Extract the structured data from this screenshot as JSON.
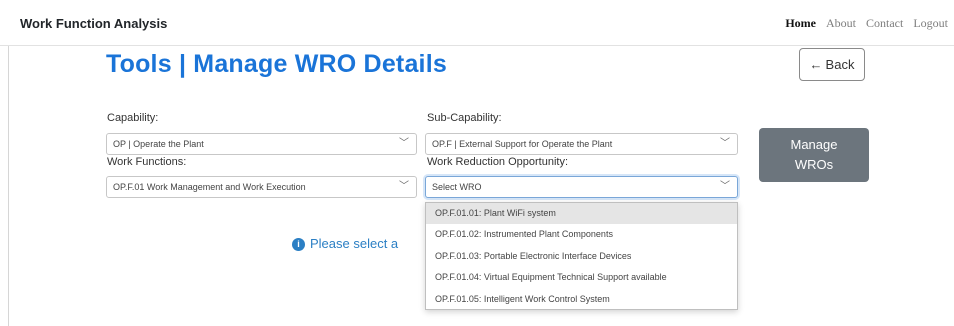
{
  "navbar": {
    "brand": "Work Function Analysis",
    "links": [
      "Home",
      "About",
      "Contact",
      "Logout"
    ]
  },
  "page": {
    "title": "Tools | Manage WRO Details",
    "back_label": "Back"
  },
  "form": {
    "capability_label": "Capability:",
    "capability_value": "OP | Operate the Plant",
    "subcapability_label": "Sub-Capability:",
    "subcapability_value": "OP.F | External Support for Operate the Plant",
    "workfunctions_label": "Work Functions:",
    "workfunctions_value": "OP.F.01 Work Management and Work Execution",
    "wro_label": "Work Reduction Opportunity:",
    "wro_value": "Select WRO",
    "wro_options": [
      "OP.F.01.01: Plant WiFi system",
      "OP.F.01.02: Instrumented Plant Components",
      "OP.F.01.03: Portable Electronic Interface Devices",
      "OP.F.01.04: Virtual Equipment Technical Support available",
      "OP.F.01.05: Intelligent Work Control System"
    ],
    "manage_line1": "Manage",
    "manage_line2": "WROs"
  },
  "info": {
    "icon": "info-icon",
    "message": "Please select a"
  },
  "colors": {
    "title": "#1a74d8",
    "manage_button": "#6c757d",
    "info": "#2b7fc4"
  }
}
